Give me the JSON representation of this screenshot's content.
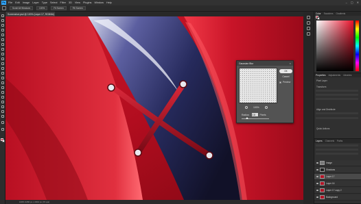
{
  "app": {
    "logo_text": "Ps",
    "menu": [
      "File",
      "Edit",
      "Image",
      "Layer",
      "Type",
      "Select",
      "Filter",
      "3D",
      "View",
      "Plugins",
      "Window",
      "Help"
    ],
    "window_controls": [
      "–",
      "▢",
      "✕"
    ]
  },
  "options_bar": {
    "buttons": [
      "Scroll All Windows",
      "100%",
      "Fit Screen",
      "Fill Screen"
    ]
  },
  "document": {
    "tab_title": "Screenshot.psd @ 100% (Layer 17, RGB/8#) *"
  },
  "status": {
    "text": "100%   3456 px x 2304 px (72 ppi)"
  },
  "dialog": {
    "title": "Gaussian Blur",
    "ok": "OK",
    "cancel": "Cancel",
    "preview_label": "Preview",
    "zoom_value": "100%",
    "radius_label": "Radius:",
    "radius_value": "2.8",
    "radius_unit": "Pixels",
    "slider_level": 0.2
  },
  "panels": {
    "color_tabs": [
      "Color",
      "Swatches",
      "Gradients"
    ],
    "fg_color": "#c8102e",
    "bg_color": "#ffffff",
    "properties_tabs": [
      "Properties",
      "Adjustments",
      "Libraries"
    ],
    "properties_title": "Pixel Layer",
    "transform_label": "Transform",
    "align_label": "Align and Distribute",
    "quick_actions_label": "Quick Actions",
    "layers_tabs": [
      "Layers",
      "Channels",
      "Paths"
    ],
    "layers": [
      {
        "name": "Image",
        "thumb": "gray",
        "selected": false
      },
      {
        "name": "Shadows",
        "thumb": "dark",
        "selected": false
      },
      {
        "name": "Layer 17",
        "thumb": "red",
        "selected": true
      },
      {
        "name": "Layer 16",
        "thumb": "red",
        "selected": false
      },
      {
        "name": "Layer 17 copy 2",
        "thumb": "red",
        "selected": false
      },
      {
        "name": "Background",
        "thumb": "red",
        "selected": false
      }
    ]
  }
}
